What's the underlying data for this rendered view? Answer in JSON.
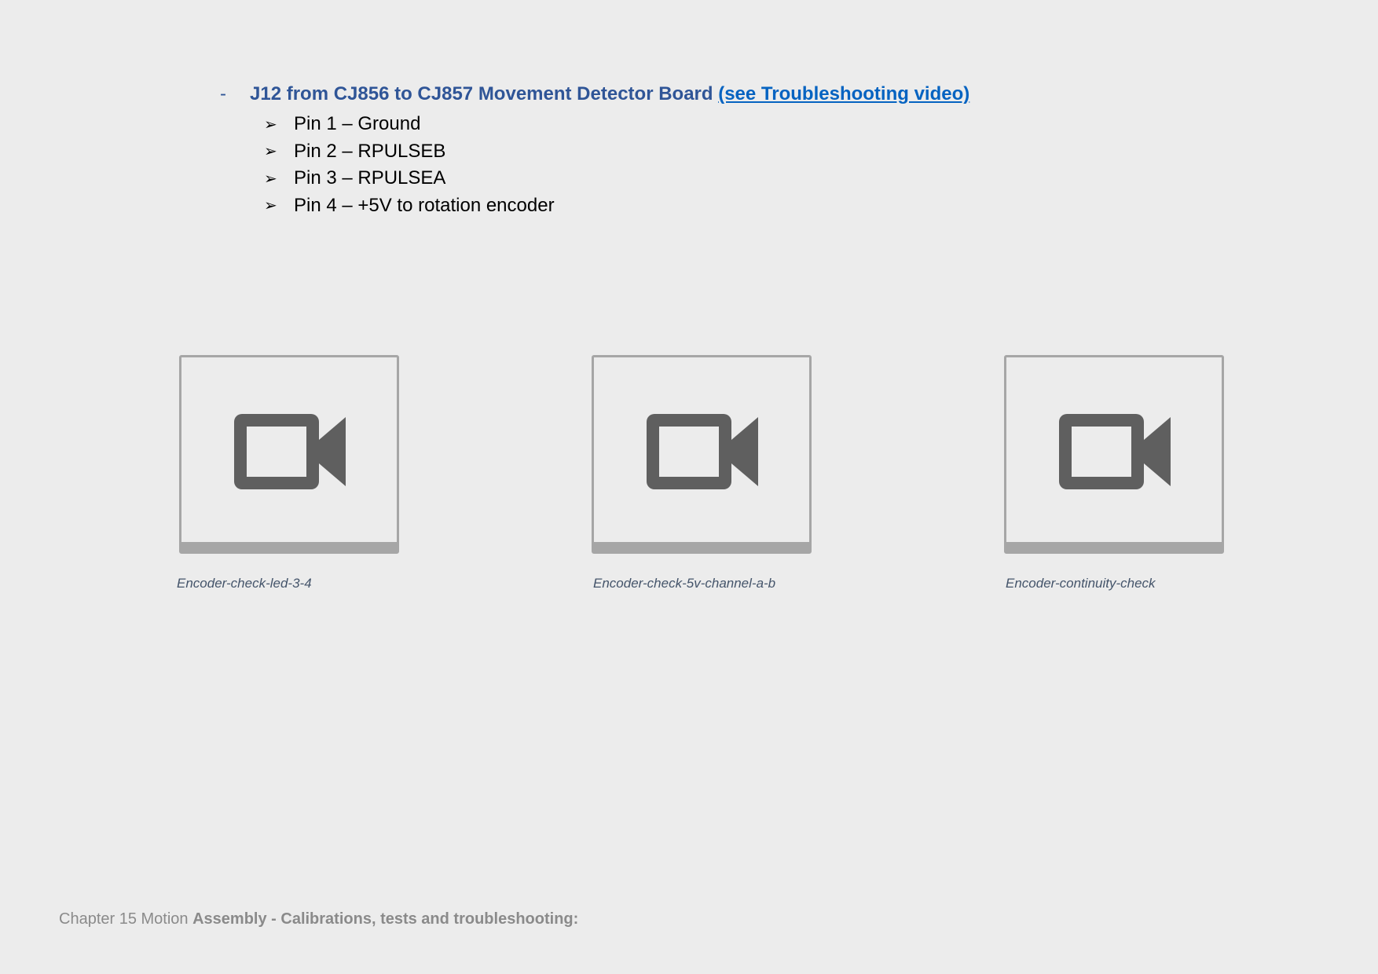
{
  "section": {
    "dash": "-",
    "title": "J12 from CJ856 to CJ857 Movement Detector Board",
    "link_text": "(see Troubleshooting video)"
  },
  "pins": [
    {
      "bullet": "➢",
      "text": "Pin 1 – Ground"
    },
    {
      "bullet": "➢",
      "text": "Pin 2 – RPULSEB"
    },
    {
      "bullet": "➢",
      "text": "Pin 3 – RPULSEA"
    },
    {
      "bullet": "➢",
      "text": "Pin 4 – +5V to rotation encoder"
    }
  ],
  "videos": [
    {
      "icon": "video-camera-icon",
      "caption": "Encoder-check-led-3-4"
    },
    {
      "icon": "video-camera-icon",
      "caption": "Encoder-check-5v-channel-a-b"
    },
    {
      "icon": "video-camera-icon",
      "caption": "Encoder-continuity-check"
    }
  ],
  "footer": {
    "chapter": "Chapter 15 Motion",
    "title": "Assembly - Calibrations, tests and troubleshooting:"
  },
  "colors": {
    "background": "#ececec",
    "heading": "#2f5597",
    "link": "#0563c1",
    "icon": "#5f5f5f",
    "tile_border": "#a6a6a6",
    "caption": "#44546a",
    "footer": "#8a8a8a"
  }
}
